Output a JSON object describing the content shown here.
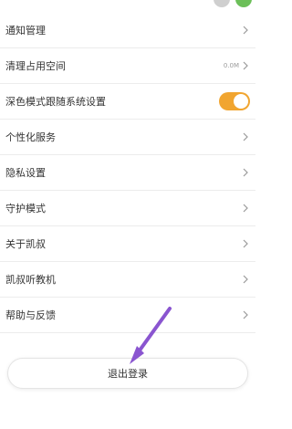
{
  "settings": {
    "items": [
      {
        "label": "通知管理",
        "type": "link"
      },
      {
        "label": "清理占用空间",
        "type": "link",
        "value": "0.0M"
      },
      {
        "label": "深色模式跟随系统设置",
        "type": "toggle",
        "toggle_on": true
      },
      {
        "label": "个性化服务",
        "type": "link"
      },
      {
        "label": "隐私设置",
        "type": "link"
      },
      {
        "label": "守护模式",
        "type": "link"
      },
      {
        "label": "关于凯叔",
        "type": "link"
      },
      {
        "label": "凯叔听教机",
        "type": "link"
      },
      {
        "label": "帮助与反馈",
        "type": "link"
      }
    ]
  },
  "logout": {
    "label": "退出登录"
  },
  "colors": {
    "toggle_on": "#f1a530",
    "arrow": "#8a55d0",
    "avatar_gray": "#cfcfcf",
    "avatar_green": "#6cbf59"
  },
  "icons": {
    "chevron": "chevron-right-icon",
    "annotation": "arrow-annotation-icon"
  }
}
